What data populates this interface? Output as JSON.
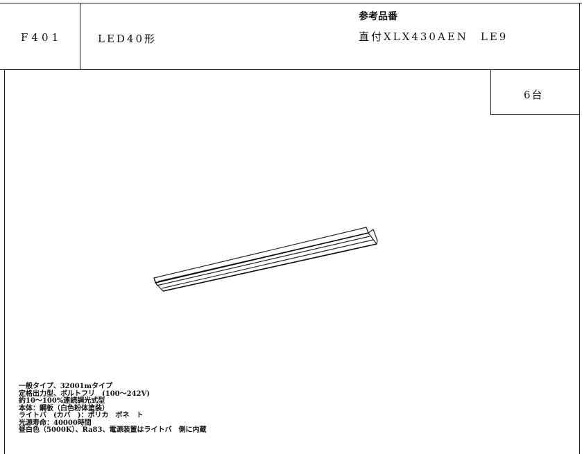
{
  "header": {
    "fixture_code": "F401",
    "fixture_type": "LED40形",
    "reference_label": "参考品番",
    "reference_value": "直付XLX430AEN　LE9"
  },
  "quantity": "6台",
  "illustration": {
    "icon": "led-linear-fixture-icon"
  },
  "specs": [
    "一般タイプ、32001mタイプ",
    "定格出力型、ボルトフリ　(100〜242V)",
    "約10〜100%連続調光式型",
    "本体：鋼板（白色粉体塗装）",
    "ライトバ　(カバ　)：ポリカ　ボネ　ト",
    "光源寿命：40000時間",
    "昼白色（5000K）、Ra83、電源装置はライトバ　側に内蔵"
  ]
}
